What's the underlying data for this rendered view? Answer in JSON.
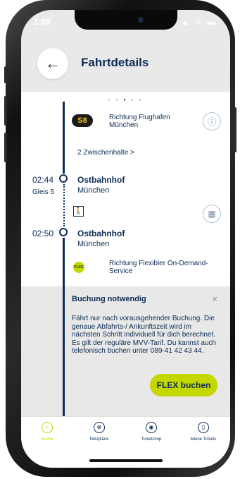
{
  "status_bar": {
    "time": "1:09",
    "right": "▲ ≈ ▬"
  },
  "header": {
    "back_icon": "←",
    "title": "Fahrtdetails"
  },
  "pager": {
    "before": "• • ",
    "active": "•",
    "after": " • •"
  },
  "segment1": {
    "line": "S8",
    "direction_line1": "Richtung Flughafen",
    "direction_line2": "München",
    "info_icon": "ⓘ",
    "stops": "2 Zwischenhalte >"
  },
  "stop1": {
    "time": "02:44",
    "track": "Gleis 5",
    "name": "Ostbahnhof",
    "city": "München"
  },
  "walk": {
    "icon": "🚶",
    "map_icon": "▦"
  },
  "stop2": {
    "time": "02:50",
    "name": "Ostbahnhof",
    "city": "München"
  },
  "segment2": {
    "badge": "FLEX",
    "direction_line1": "Richtung Flexibler On-Demand-",
    "direction_line2": "Service"
  },
  "notice": {
    "title": "Buchung notwendig",
    "close_icon": "×",
    "text": "Fährt nur nach vorausgehender Buchung. Die genaue Abfahrts-/ Ankunftszeit wird im nächsten Schritt individuell für dich berechnet. Es gilt der reguläre MVV-Tarif. Du kannst auch telefonisch buchen unter 089-41 42 43 44.",
    "button": "FLEX buchen"
  },
  "tabs": [
    {
      "label": "Suche",
      "icon": "⌕"
    },
    {
      "label": "Netzpläne",
      "icon": "⊗"
    },
    {
      "label": "Ticketshop",
      "icon": "◉"
    },
    {
      "label": "Meine Tickets",
      "icon": "▯"
    }
  ],
  "colors": {
    "brand_navy": "#0c2d54",
    "accent_lime": "#c4d800",
    "s8_yellow": "#f5c400"
  }
}
